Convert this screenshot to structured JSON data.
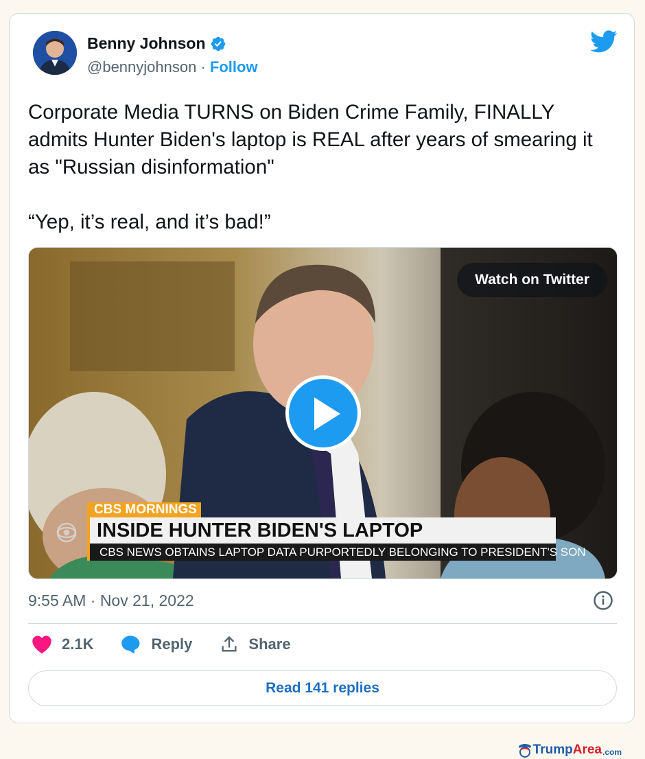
{
  "author": {
    "name": "Benny Johnson",
    "handle": "@bennyjohnson",
    "separator": "·",
    "follow_label": "Follow",
    "verified": true
  },
  "tweet": {
    "text": "Corporate Media TURNS on Biden Crime Family, FINALLY admits Hunter Biden's laptop is REAL after years of smearing it as \"Russian disinformation\"",
    "quote": "“Yep, it’s real, and it’s bad!”",
    "timestamp": "9:55 AM · Nov 21, 2022"
  },
  "media": {
    "watch_label": "Watch on Twitter",
    "brand": "CBS MORNINGS",
    "headline": "INSIDE HUNTER BIDEN'S LAPTOP",
    "subheadline": "CBS NEWS OBTAINS LAPTOP DATA PURPORTEDLY BELONGING TO PRESIDENT'S SON"
  },
  "actions": {
    "like_count": "2.1K",
    "reply_label": "Reply",
    "share_label": "Share",
    "read_replies_label": "Read 141 replies"
  },
  "watermark": {
    "trump": "Trump",
    "area": "Area",
    "com": ".com"
  },
  "colors": {
    "twitter_blue": "#1d9bf0",
    "like_pink": "#f91880",
    "cbs_orange": "#f2a322",
    "text_primary": "#0f1419",
    "text_secondary": "#536471"
  },
  "icons": [
    "verified-badge-icon",
    "twitter-bird-icon",
    "play-icon",
    "info-icon",
    "heart-icon",
    "reply-bubble-icon",
    "share-icon",
    "cbs-eye-icon"
  ]
}
